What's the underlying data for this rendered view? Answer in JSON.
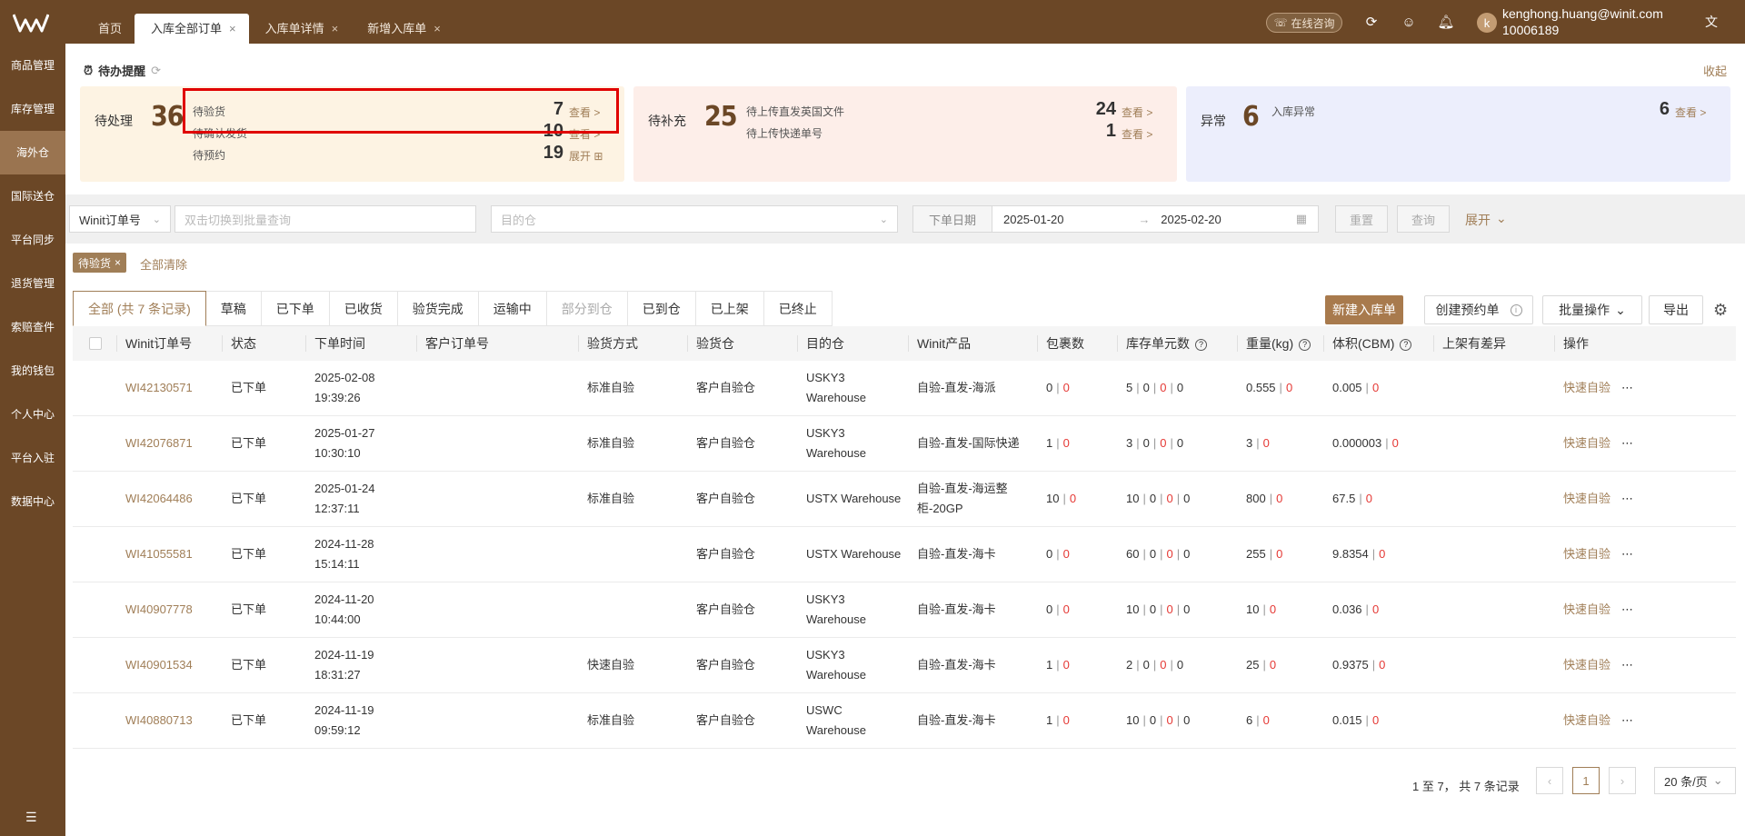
{
  "header": {
    "tabs": [
      {
        "label": "首页",
        "closable": false
      },
      {
        "label": "入库全部订单",
        "closable": true,
        "active": true
      },
      {
        "label": "入库单详情",
        "closable": true
      },
      {
        "label": "新增入库单",
        "closable": true
      }
    ],
    "consult_label": "在线咨询",
    "avatar_letter": "k",
    "user_email": "kenghong.huang@winit.com",
    "user_id": "10006189"
  },
  "sidebar": {
    "items": [
      "商品管理",
      "库存管理",
      "海外仓",
      "国际送仓",
      "平台同步",
      "退货管理",
      "索赔查件",
      "我的钱包",
      "个人中心",
      "平台入驻",
      "数据中心"
    ],
    "active_index": 2
  },
  "todo": {
    "title": "待办提醒",
    "collapse": "收起",
    "cards": [
      {
        "label": "待处理",
        "total": "36",
        "rows": [
          {
            "label": "待验货",
            "count": "7",
            "link": "查看 >"
          },
          {
            "label": "待确认发货",
            "count": "10",
            "link": "查看 >"
          },
          {
            "label": "待预约",
            "count": "19",
            "link": "展开 ⊞"
          }
        ]
      },
      {
        "label": "待补充",
        "total": "25",
        "rows": [
          {
            "label": "待上传直发英国文件",
            "count": "24",
            "link": "查看 >"
          },
          {
            "label": "待上传快递单号",
            "count": "1",
            "link": "查看 >"
          }
        ]
      },
      {
        "label": "异常",
        "total": "6",
        "rows": [
          {
            "label": "入库异常",
            "count": "6",
            "link": "查看 >"
          }
        ]
      }
    ]
  },
  "filter": {
    "order_type": "Winit订单号",
    "search_placeholder": "双击切换到批量查询",
    "warehouse_placeholder": "目的仓",
    "date_label": "下单日期",
    "date_from": "2025-01-20",
    "date_to": "2025-02-20",
    "reset": "重置",
    "query": "查询",
    "expand": "展开"
  },
  "chips": {
    "active": "待验货",
    "clear": "全部清除"
  },
  "status_tabs": [
    "全部 (共 7 条记录)",
    "草稿",
    "已下单",
    "已收货",
    "验货完成",
    "运输中",
    "部分到仓",
    "已到仓",
    "已上架",
    "已终止"
  ],
  "actions": {
    "new": "新建入库单",
    "appointment": "创建预约单",
    "batch": "批量操作",
    "export": "导出"
  },
  "table": {
    "columns": [
      "Winit订单号",
      "状态",
      "下单时间",
      "客户订单号",
      "验货方式",
      "验货仓",
      "目的仓",
      "Winit产品",
      "包裹数",
      "库存单元数",
      "重量(kg)",
      "体积(CBM)",
      "上架有差异",
      "操作"
    ],
    "rows": [
      {
        "order": "WI42130571",
        "status": "已下单",
        "date": "2025-02-08",
        "time": "19:39:26",
        "customer": "",
        "method": "标准自验",
        "inspect": "客户自验仓",
        "dest1": "USKY3",
        "dest2": "Warehouse",
        "product1": "自验-直发-海派",
        "product2": "",
        "pkg": [
          "0",
          "0"
        ],
        "sku": [
          "5",
          "0",
          "0",
          "0"
        ],
        "weight": [
          "0.555",
          "0"
        ],
        "volume": [
          "0.005",
          "0"
        ],
        "op": "快速自验"
      },
      {
        "order": "WI42076871",
        "status": "已下单",
        "date": "2025-01-27",
        "time": "10:30:10",
        "customer": "",
        "method": "标准自验",
        "inspect": "客户自验仓",
        "dest1": "USKY3",
        "dest2": "Warehouse",
        "product1": "自验-直发-国际快递",
        "product2": "",
        "pkg": [
          "1",
          "0"
        ],
        "sku": [
          "3",
          "0",
          "0",
          "0"
        ],
        "weight": [
          "3",
          "0"
        ],
        "volume": [
          "0.000003",
          "0"
        ],
        "op": "快速自验"
      },
      {
        "order": "WI42064486",
        "status": "已下单",
        "date": "2025-01-24",
        "time": "12:37:11",
        "customer": "",
        "method": "标准自验",
        "inspect": "客户自验仓",
        "dest1": "USTX Warehouse",
        "dest2": "",
        "product1": "自验-直发-海运整",
        "product2": "柜-20GP",
        "pkg": [
          "10",
          "0"
        ],
        "sku": [
          "10",
          "0",
          "0",
          "0"
        ],
        "weight": [
          "800",
          "0"
        ],
        "volume": [
          "67.5",
          "0"
        ],
        "op": "快速自验"
      },
      {
        "order": "WI41055581",
        "status": "已下单",
        "date": "2024-11-28",
        "time": "15:14:11",
        "customer": "",
        "method": "",
        "inspect": "客户自验仓",
        "dest1": "USTX Warehouse",
        "dest2": "",
        "product1": "自验-直发-海卡",
        "product2": "",
        "pkg": [
          "0",
          "0"
        ],
        "sku": [
          "60",
          "0",
          "0",
          "0"
        ],
        "weight": [
          "255",
          "0"
        ],
        "volume": [
          "9.8354",
          "0"
        ],
        "op": "快速自验"
      },
      {
        "order": "WI40907778",
        "status": "已下单",
        "date": "2024-11-20",
        "time": "10:44:00",
        "customer": "",
        "method": "",
        "inspect": "客户自验仓",
        "dest1": "USKY3",
        "dest2": "Warehouse",
        "product1": "自验-直发-海卡",
        "product2": "",
        "pkg": [
          "0",
          "0"
        ],
        "sku": [
          "10",
          "0",
          "0",
          "0"
        ],
        "weight": [
          "10",
          "0"
        ],
        "volume": [
          "0.036",
          "0"
        ],
        "op": "快速自验"
      },
      {
        "order": "WI40901534",
        "status": "已下单",
        "date": "2024-11-19",
        "time": "18:31:27",
        "customer": "",
        "method": "快速自验",
        "inspect": "客户自验仓",
        "dest1": "USKY3",
        "dest2": "Warehouse",
        "product1": "自验-直发-海卡",
        "product2": "",
        "pkg": [
          "1",
          "0"
        ],
        "sku": [
          "2",
          "0",
          "0",
          "0"
        ],
        "weight": [
          "25",
          "0"
        ],
        "volume": [
          "0.9375",
          "0"
        ],
        "op": "快速自验"
      },
      {
        "order": "WI40880713",
        "status": "已下单",
        "date": "2024-11-19",
        "time": "09:59:12",
        "customer": "",
        "method": "标准自验",
        "inspect": "客户自验仓",
        "dest1": "USWC",
        "dest2": "Warehouse",
        "product1": "自验-直发-海卡",
        "product2": "",
        "pkg": [
          "1",
          "0"
        ],
        "sku": [
          "10",
          "0",
          "0",
          "0"
        ],
        "weight": [
          "6",
          "0"
        ],
        "volume": [
          "0.015",
          "0"
        ],
        "op": "快速自验"
      }
    ]
  },
  "pagination": {
    "summary": "1 至 7， 共 7 条记录",
    "current": "1",
    "page_size": "20 条/页"
  },
  "colors": {
    "brand": "#6b4726",
    "accent": "#a07e57",
    "danger": "#e53935"
  }
}
